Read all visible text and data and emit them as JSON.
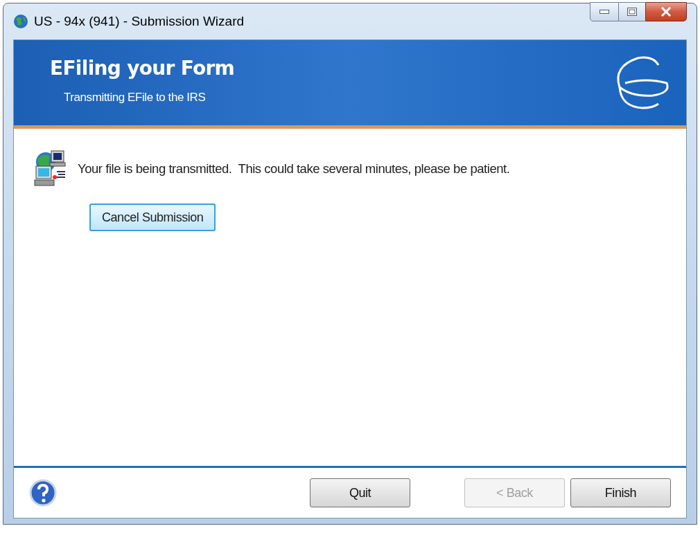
{
  "window": {
    "title": "US - 94x (941) - Submission Wizard"
  },
  "banner": {
    "title": "EFiling your Form",
    "subtitle": "Transmitting EFile to the IRS"
  },
  "message": "Your file is being transmitted.  This could take several minutes, please be patient.",
  "cancel_button": {
    "label": "Cancel Submission",
    "focused": true
  },
  "footer_buttons": [
    {
      "label": "Quit",
      "disabled": false
    },
    {
      "label": "< Back",
      "disabled": true
    },
    {
      "label": "Finish",
      "disabled": false
    }
  ]
}
